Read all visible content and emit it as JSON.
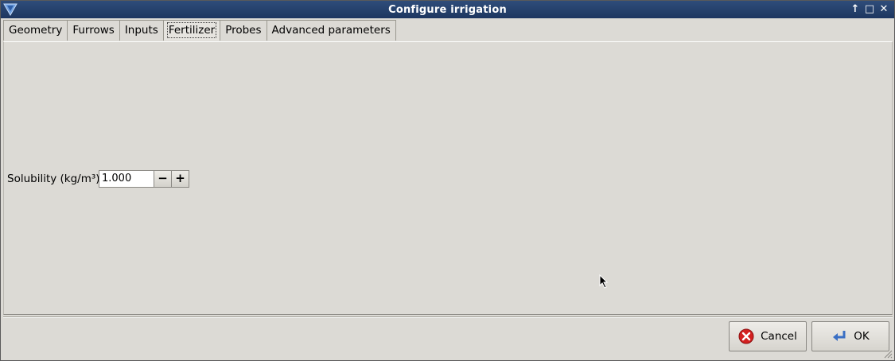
{
  "window": {
    "title": "Configure irrigation"
  },
  "titlebar_buttons": {
    "up": "↑",
    "maximize": "□",
    "close": "✕"
  },
  "tabs": [
    {
      "label": "Geometry",
      "active": false
    },
    {
      "label": "Furrows",
      "active": false
    },
    {
      "label": "Inputs",
      "active": false
    },
    {
      "label": "Fertilizer",
      "active": true
    },
    {
      "label": "Probes",
      "active": false
    },
    {
      "label": "Advanced parameters",
      "active": false
    }
  ],
  "fertilizer": {
    "solubility_label": "Solubility (kg/m³)",
    "solubility_value": "1.000",
    "decrement": "−",
    "increment": "+"
  },
  "buttons": {
    "cancel_label": "Cancel",
    "cancel_icon": "cancel-icon",
    "ok_label": "OK",
    "ok_icon": "enter-arrow-icon"
  },
  "colors": {
    "titlebar": "#1d3660",
    "background": "#dcdad5",
    "cancel_red": "#d32020",
    "ok_blue": "#3a6fc4"
  }
}
